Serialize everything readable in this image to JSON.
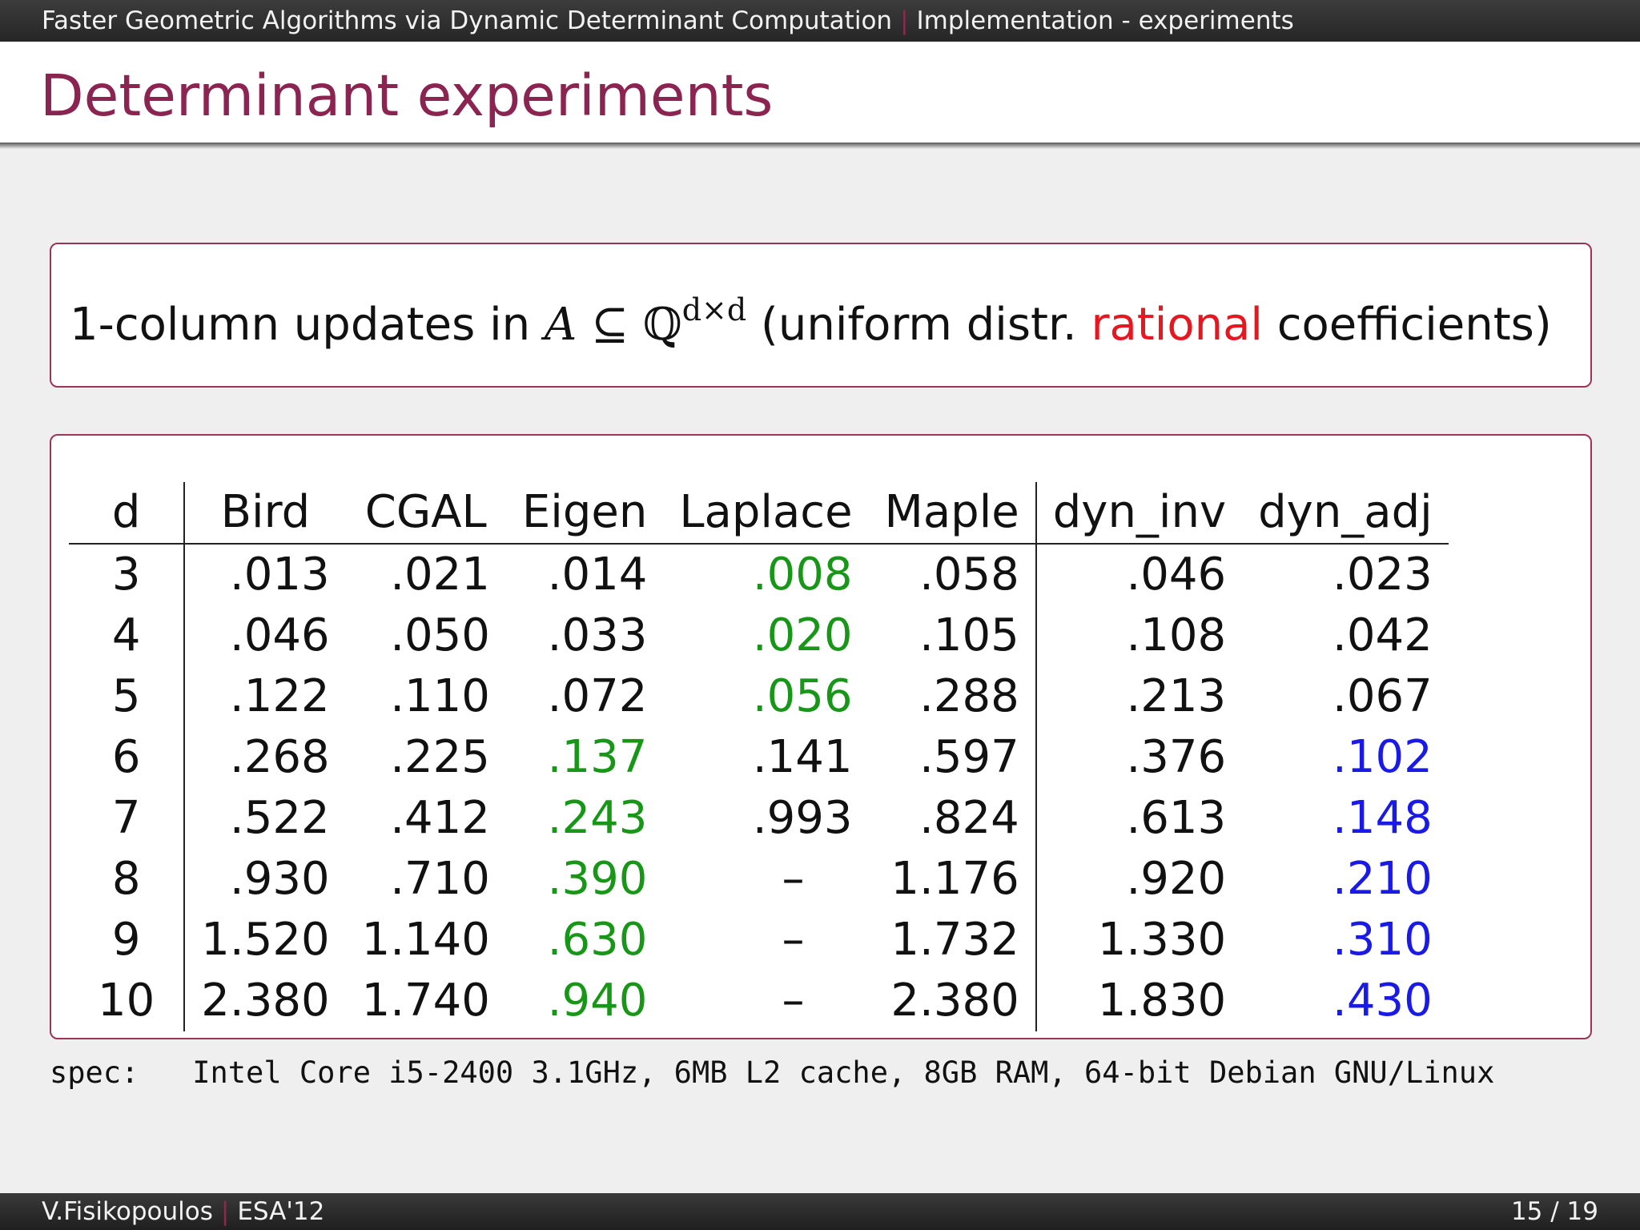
{
  "header": {
    "talk_title": "Faster Geometric Algorithms via Dynamic Determinant Computation",
    "separator": "|",
    "section": "Implementation - experiments"
  },
  "slide": {
    "title": "Determinant experiments"
  },
  "statement": {
    "prefix": "1-column updates in ",
    "math_var": "A",
    "math_subset": " ⊆ ",
    "math_field": "ℚ",
    "math_exponent": "d×d",
    "middle": " (uniform distr. ",
    "highlight": "rational",
    "suffix": " coefficients)",
    "highlight_color": "#e8161f"
  },
  "table": {
    "headers": [
      "d",
      "Bird",
      "CGAL",
      "Eigen",
      "Laplace",
      "Maple",
      "dyn_inv",
      "dyn_adj"
    ],
    "rows": [
      [
        "3",
        ".013",
        ".021",
        ".014",
        ".008",
        ".058",
        ".046",
        ".023"
      ],
      [
        "4",
        ".046",
        ".050",
        ".033",
        ".020",
        ".105",
        ".108",
        ".042"
      ],
      [
        "5",
        ".122",
        ".110",
        ".072",
        ".056",
        ".288",
        ".213",
        ".067"
      ],
      [
        "6",
        ".268",
        ".225",
        ".137",
        ".141",
        ".597",
        ".376",
        ".102"
      ],
      [
        "7",
        ".522",
        ".412",
        ".243",
        ".993",
        ".824",
        ".613",
        ".148"
      ],
      [
        "8",
        ".930",
        ".710",
        ".390",
        "–",
        "1.176",
        ".920",
        ".210"
      ],
      [
        "9",
        "1.520",
        "1.140",
        ".630",
        "–",
        "1.732",
        "1.330",
        ".310"
      ],
      [
        "10",
        "2.380",
        "1.740",
        ".940",
        "–",
        "2.380",
        "1.830",
        ".430"
      ]
    ],
    "cell_colors": [
      [
        "",
        "",
        "",
        "",
        "green",
        "",
        "",
        ""
      ],
      [
        "",
        "",
        "",
        "",
        "green",
        "",
        "",
        ""
      ],
      [
        "",
        "",
        "",
        "",
        "green",
        "",
        "",
        ""
      ],
      [
        "",
        "",
        "",
        "green",
        "",
        "",
        "",
        "blue"
      ],
      [
        "",
        "",
        "",
        "green",
        "",
        "",
        "",
        "blue"
      ],
      [
        "",
        "",
        "",
        "green",
        "",
        "",
        "",
        "blue"
      ],
      [
        "",
        "",
        "",
        "green",
        "",
        "",
        "",
        "blue"
      ],
      [
        "",
        "",
        "",
        "green",
        "",
        "",
        "",
        "blue"
      ]
    ],
    "colors": {
      "green": "#179617",
      "blue": "#1a1ae6"
    }
  },
  "spec": {
    "label": "spec:",
    "text": "Intel Core i5-2400 3.1GHz, 6MB L2 cache, 8GB RAM, 64-bit Debian GNU/Linux"
  },
  "footer": {
    "author": "V.Fisikopoulos",
    "separator": "|",
    "venue": "ESA'12",
    "page": "15 / 19"
  }
}
